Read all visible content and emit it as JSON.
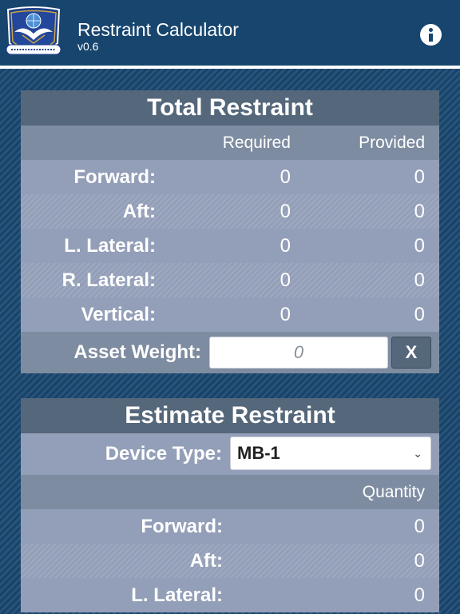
{
  "header": {
    "title": "Restraint Calculator",
    "version": "v0.6",
    "logo_icon": "unit-emblem-icon",
    "info_icon": "info-icon"
  },
  "total_restraint": {
    "title": "Total Restraint",
    "col_required": "Required",
    "col_provided": "Provided",
    "rows": [
      {
        "label": "Forward:",
        "required": "0",
        "provided": "0"
      },
      {
        "label": "Aft:",
        "required": "0",
        "provided": "0"
      },
      {
        "label": "L. Lateral:",
        "required": "0",
        "provided": "0"
      },
      {
        "label": "R. Lateral:",
        "required": "0",
        "provided": "0"
      },
      {
        "label": "Vertical:",
        "required": "0",
        "provided": "0"
      }
    ],
    "asset_weight_label": "Asset Weight:",
    "asset_weight_placeholder": "0",
    "asset_weight_value": "",
    "clear_label": "X"
  },
  "estimate_restraint": {
    "title": "Estimate Restraint",
    "device_type_label": "Device Type:",
    "device_type_value": "MB-1",
    "col_quantity": "Quantity",
    "rows": [
      {
        "label": "Forward:",
        "quantity": "0"
      },
      {
        "label": "Aft:",
        "quantity": "0"
      },
      {
        "label": "L. Lateral:",
        "quantity": "0"
      }
    ]
  },
  "colors": {
    "header_bg": "#17456e",
    "panel_title_bg": "#55677a",
    "row_bg": "#939fb8",
    "header_row_bg": "#7e8ca1"
  }
}
